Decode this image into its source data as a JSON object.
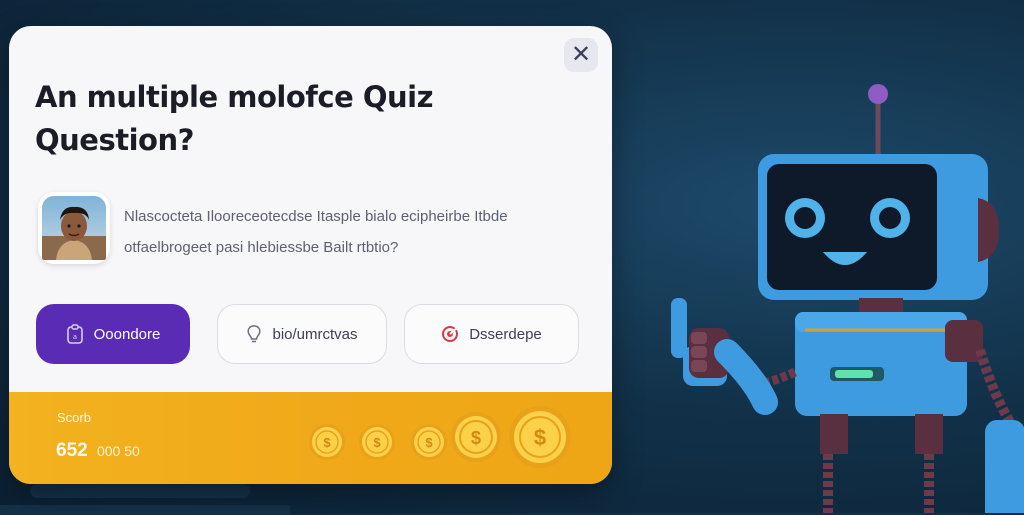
{
  "modal": {
    "close_label": "✕",
    "title_line1": "An multiple molofce Quiz",
    "title_line2": "Question?",
    "question_line1": "Nlascocteta Ilooreceotecdse Itasple bialo ecipheirbe Itbde",
    "question_line2": "otfaelbrogeet pasi hlebiessbe Bailt rtbtio?",
    "answers": [
      {
        "label": "Ooondore",
        "icon": "clipboard-icon",
        "selected": true
      },
      {
        "label": "bio/umrctvas",
        "icon": "lightbulb-icon",
        "selected": false
      },
      {
        "label": "Dsserdepe",
        "icon": "target-icon",
        "selected": false
      }
    ],
    "score": {
      "label": "Scorb",
      "value": "652",
      "suffix": "000 50"
    },
    "coins": [
      "coin-icon",
      "coin-icon",
      "coin-icon",
      "coin-icon",
      "coin-icon"
    ]
  },
  "colors": {
    "accent": "#5a2bb5",
    "score_bar": "#f0a91a",
    "robot_body": "#3e9be0",
    "background": "#12324a"
  }
}
